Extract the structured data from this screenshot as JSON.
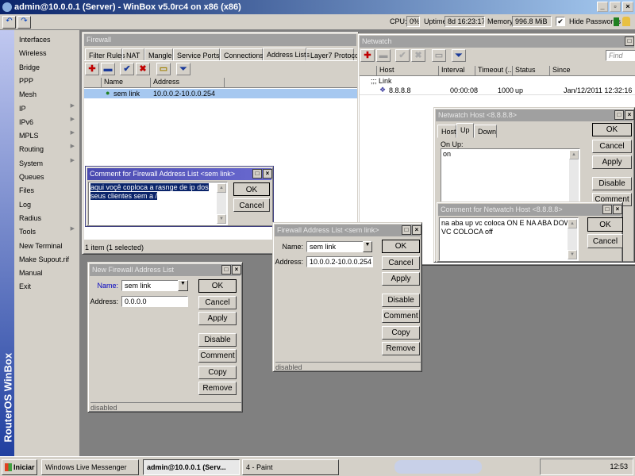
{
  "app": {
    "title": "admin@10.0.0.1 (Server) - WinBox v5.0rc4 on x86 (x86)",
    "undo": "↶",
    "redo": "↷",
    "cpu_label": "CPU:",
    "cpu": "0%",
    "uptime_label": "Uptime:",
    "uptime": "8d 16:23:17",
    "memory_label": "Memory:",
    "memory": "996.8 MiB",
    "hide_passwords": "Hide Passwords",
    "hide_passwords_checked": true
  },
  "sidebar": {
    "brand": "RouterOS WinBox",
    "items": [
      {
        "label": "Interfaces",
        "sub": false
      },
      {
        "label": "Wireless",
        "sub": false
      },
      {
        "label": "Bridge",
        "sub": false
      },
      {
        "label": "PPP",
        "sub": false
      },
      {
        "label": "Mesh",
        "sub": false
      },
      {
        "label": "IP",
        "sub": true
      },
      {
        "label": "IPv6",
        "sub": true
      },
      {
        "label": "MPLS",
        "sub": true
      },
      {
        "label": "Routing",
        "sub": true
      },
      {
        "label": "System",
        "sub": true
      },
      {
        "label": "Queues",
        "sub": false
      },
      {
        "label": "Files",
        "sub": false
      },
      {
        "label": "Log",
        "sub": false
      },
      {
        "label": "Radius",
        "sub": false
      },
      {
        "label": "Tools",
        "sub": true
      },
      {
        "label": "New Terminal",
        "sub": false
      },
      {
        "label": "Make Supout.rif",
        "sub": false
      },
      {
        "label": "Manual",
        "sub": false
      },
      {
        "label": "Exit",
        "sub": false
      }
    ]
  },
  "firewall": {
    "title": "Firewall",
    "tabs": [
      "Filter Rules",
      "NAT",
      "Mangle",
      "Service Ports",
      "Connections",
      "Address Lists",
      "Layer7 Protoco"
    ],
    "active_tab": "Address Lists",
    "columns": [
      "Name",
      "Address"
    ],
    "rows": [
      {
        "name": "sem link",
        "address": "10.0.0.2-10.0.0.254",
        "selected": true
      }
    ],
    "status": "1 item (1 selected)",
    "find_placeholder": "F"
  },
  "fw_comment": {
    "title": "Comment for Firewall Address List <sem link>",
    "text": "aqui voçê coploca a rasnge de ip dos seus clientes sem a  /",
    "ok": "OK",
    "cancel": "Cancel"
  },
  "fw_addr": {
    "title": "Firewall Address List <sem link>",
    "name_label": "Name:",
    "name": "sem link",
    "address_label": "Address:",
    "address": "10.0.0.2-10.0.0.254",
    "buttons": [
      "OK",
      "Cancel",
      "Apply",
      "Disable",
      "Comment",
      "Copy",
      "Remove"
    ],
    "status": "disabled"
  },
  "new_fw_addr": {
    "title": "New Firewall Address List",
    "name_label": "Name:",
    "name": "sem link",
    "address_label": "Address:",
    "address": "0.0.0.0",
    "buttons": [
      "OK",
      "Cancel",
      "Apply",
      "Disable",
      "Comment",
      "Copy",
      "Remove"
    ],
    "status": "disabled"
  },
  "netwatch": {
    "title": "Netwatch",
    "find_placeholder": "Find",
    "columns": [
      "Host",
      "Interval",
      "Timeout (...",
      "Status",
      "Since"
    ],
    "comment_row": ";;; Link",
    "rows": [
      {
        "host": "8.8.8.8",
        "interval": "00:00:08",
        "timeout": "1000",
        "status": "up",
        "since": "Jan/12/2011 12:32:16"
      }
    ]
  },
  "nw_host": {
    "title": "Netwatch Host <8.8.8.8>",
    "tabs": [
      "Host",
      "Up",
      "Down"
    ],
    "active_tab": "Up",
    "on_up_label": "On Up:",
    "on_up": "on",
    "buttons": [
      "OK",
      "Cancel",
      "Apply",
      "Disable",
      "Comment"
    ]
  },
  "nw_comment": {
    "title": "Comment for Netwatch Host <8.8.8.8>",
    "text": "na aba up  vc coloca  ON E NA ABA DOWN VC COLOCA off",
    "ok": "OK",
    "cancel": "Cancel"
  },
  "taskbar": {
    "start": "Iniciar",
    "tasks": [
      "Windows Live Messenger",
      "admin@10.0.0.1 (Serv...",
      "4 - Paint"
    ],
    "active_task": 1,
    "clock": "12:53"
  },
  "colors": {
    "titlebar": "#0a246a",
    "selection": "#a6c8f0",
    "active_dialog": "#4a4ab0"
  }
}
